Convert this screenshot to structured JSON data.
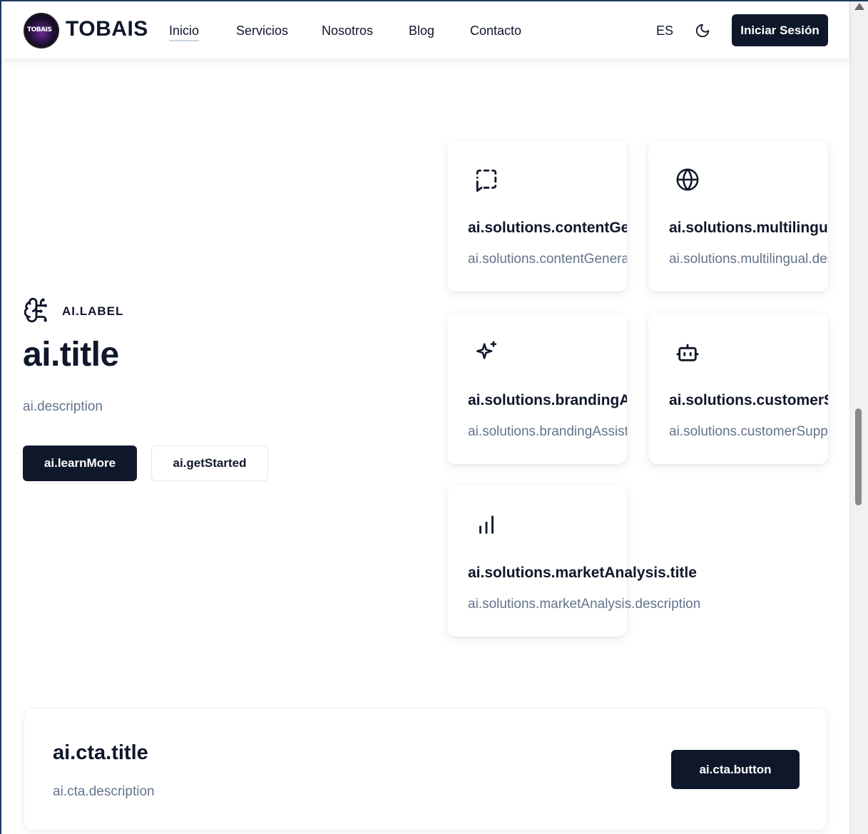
{
  "header": {
    "logo_text": "TOBAIS",
    "brand": "TOBAIS",
    "nav": [
      {
        "label": "Inicio",
        "active": true
      },
      {
        "label": "Servicios"
      },
      {
        "label": "Nosotros"
      },
      {
        "label": "Blog"
      },
      {
        "label": "Contacto"
      }
    ],
    "language": "ES",
    "theme_icon": "moon-icon",
    "login_label": "Iniciar Sesión"
  },
  "hero": {
    "icon": "brain-icon",
    "label": "AI.LABEL",
    "title": "ai.title",
    "description": "ai.description",
    "primary_button": "ai.learnMore",
    "secondary_button": "ai.getStarted"
  },
  "solutions": [
    {
      "icon": "message-dashed-icon",
      "title": "ai.solutions.contentGeneration.title",
      "description": "ai.solutions.contentGeneration.description"
    },
    {
      "icon": "globe-icon",
      "title": "ai.solutions.multilingual.title",
      "description": "ai.solutions.multilingual.description"
    },
    {
      "icon": "sparkles-icon",
      "title": "ai.solutions.brandingAssistant.title",
      "description": "ai.solutions.brandingAssistant.description"
    },
    {
      "icon": "bot-icon",
      "title": "ai.solutions.customerSupport.title",
      "description": "ai.solutions.customerSupport.description"
    },
    {
      "icon": "bar-chart-icon",
      "title": "ai.solutions.marketAnalysis.title",
      "description": "ai.solutions.marketAnalysis.description"
    }
  ],
  "cta": {
    "title": "ai.cta.title",
    "description": "ai.cta.description",
    "button": "ai.cta.button"
  },
  "colors": {
    "primary": "#0f172a",
    "muted_text": "#64748b",
    "border": "#e2e8f0"
  }
}
